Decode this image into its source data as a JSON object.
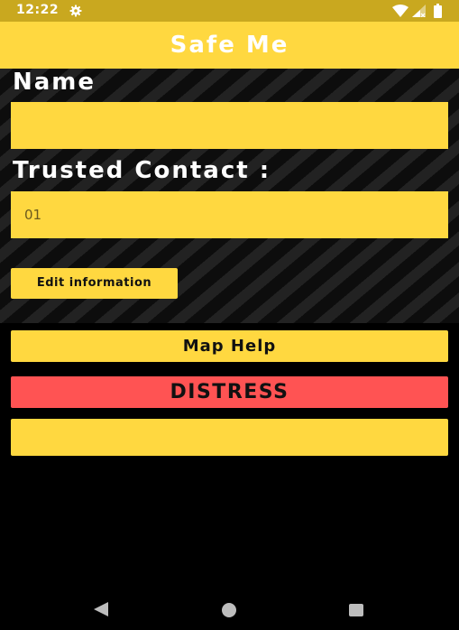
{
  "status_bar": {
    "time": "12:22",
    "icons": [
      "gear-icon",
      "wifi-icon",
      "signal-icon",
      "battery-icon"
    ]
  },
  "app_bar": {
    "title": "Safe Me"
  },
  "form": {
    "name_label": "Name",
    "name_value": "",
    "contact_label": "Trusted Contact :",
    "contact_value": "01"
  },
  "buttons": {
    "edit": "Edit information",
    "map_help": "Map Help",
    "distress": "DISTRESS",
    "extra": ""
  },
  "nav_bar": {
    "icons": [
      "back-icon",
      "home-icon",
      "recents-icon"
    ]
  },
  "colors": {
    "accent": "#ffd840",
    "status_bar": "#c9a81f",
    "distress": "#ff5353",
    "background": "#000000"
  }
}
